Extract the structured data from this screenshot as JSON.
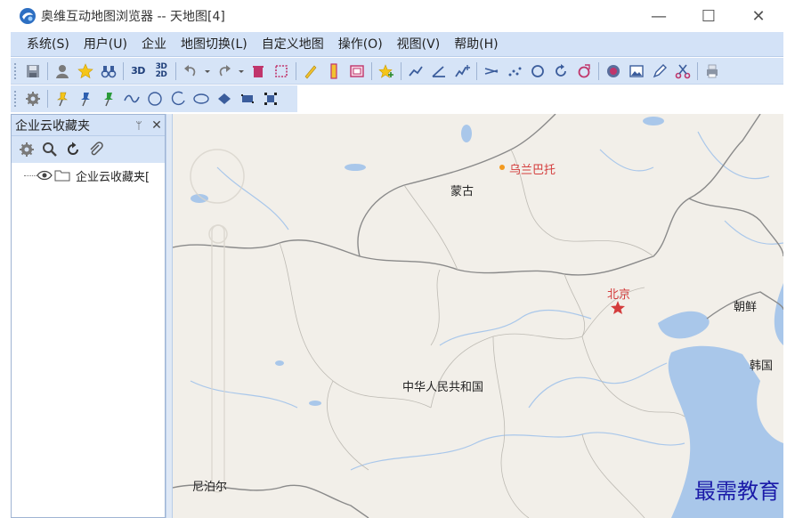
{
  "window": {
    "title": "奥维互动地图浏览器 -- 天地图[4]",
    "controls": [
      "—",
      "☐",
      "✕"
    ]
  },
  "menu": [
    {
      "label": "系统(S)",
      "name": "menu-system"
    },
    {
      "label": "用户(U)",
      "name": "menu-user"
    },
    {
      "label": "企业",
      "name": "menu-enterprise"
    },
    {
      "label": "地图切换(L)",
      "name": "menu-map-switch"
    },
    {
      "label": "自定义地图",
      "name": "menu-custom-map"
    },
    {
      "label": "操作(O)",
      "name": "menu-operation"
    },
    {
      "label": "视图(V)",
      "name": "menu-view"
    },
    {
      "label": "帮助(H)",
      "name": "menu-help"
    }
  ],
  "toolbar": {
    "btn_3d": "3D",
    "btn_3d2d_top": "3D",
    "btn_3d2d_bottom": "2D"
  },
  "panel": {
    "title": "企业云收藏夹",
    "pin": "ᛘ",
    "close": "✕",
    "tree_item": "企业云收藏夹["
  },
  "map": {
    "labels": {
      "ulaanbaatar": "乌兰巴托",
      "mongolia": "蒙古",
      "beijing": "北京",
      "north_korea": "朝鲜",
      "south_korea": "韩国",
      "china": "中华人民共和国",
      "nepal": "尼泊尔"
    },
    "colors": {
      "land": "#f2efe9",
      "water": "#a9c7ea",
      "border": "#8a8a8a",
      "city": "#d43c3c"
    }
  },
  "watermark": "最需教育"
}
